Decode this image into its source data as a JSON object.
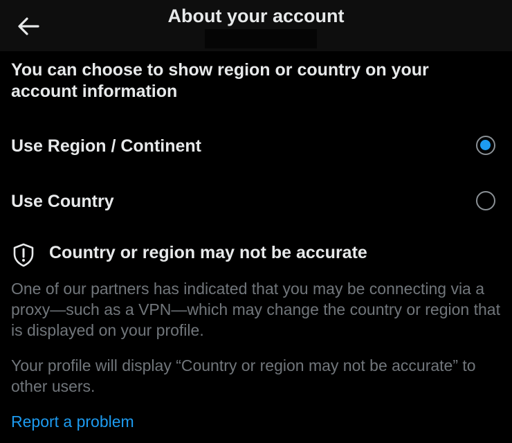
{
  "header": {
    "title": "About your account",
    "back_icon": "arrow-left-icon"
  },
  "intro": "You can choose to show region or country on your account information",
  "options": [
    {
      "label": "Use Region / Continent",
      "selected": true
    },
    {
      "label": "Use Country",
      "selected": false
    }
  ],
  "warning": {
    "icon": "shield-exclamation-icon",
    "title": "Country or region may not be accurate",
    "paragraph_1": "One of our partners has indicated that you may be connecting via a proxy—such as a VPN—which may change the country or region that is displayed on your profile.",
    "paragraph_2": "Your profile will display “Country or region may not be accurate” to other users."
  },
  "report_link": "Report a problem",
  "colors": {
    "background": "#000000",
    "primary_text": "#e7e9ea",
    "secondary_text": "#71767b",
    "accent": "#1d9bf0"
  }
}
